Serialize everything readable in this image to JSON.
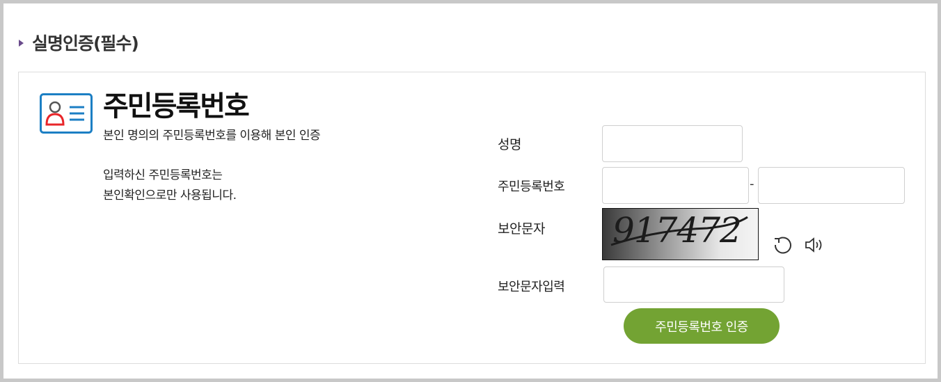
{
  "section": {
    "title": "실명인증(필수)"
  },
  "panel": {
    "icon": "id-card-icon",
    "title": "주민등록번호",
    "description": "본인 명의의 주민등록번호를 이용해 본인 인증",
    "note_line1": "입력하신 주민등록번호는",
    "note_line2": "본인확인으로만 사용됩니다."
  },
  "form": {
    "name_label": "성명",
    "name_value": "",
    "rrn_label": "주민등록번호",
    "rrn_first_value": "",
    "rrn_second_value": "",
    "rrn_separator": "-",
    "captcha_label": "보안문자",
    "captcha_text": "917472",
    "refresh_icon": "refresh-icon",
    "audio_icon": "speaker-icon",
    "captcha_input_label": "보안문자입력",
    "captcha_input_value": "",
    "submit_label": "주민등록번호 인증"
  },
  "colors": {
    "accent": "#73a333",
    "marker": "#6a4b8c",
    "icon_blue": "#1c7fc4",
    "icon_red": "#e8262a"
  }
}
